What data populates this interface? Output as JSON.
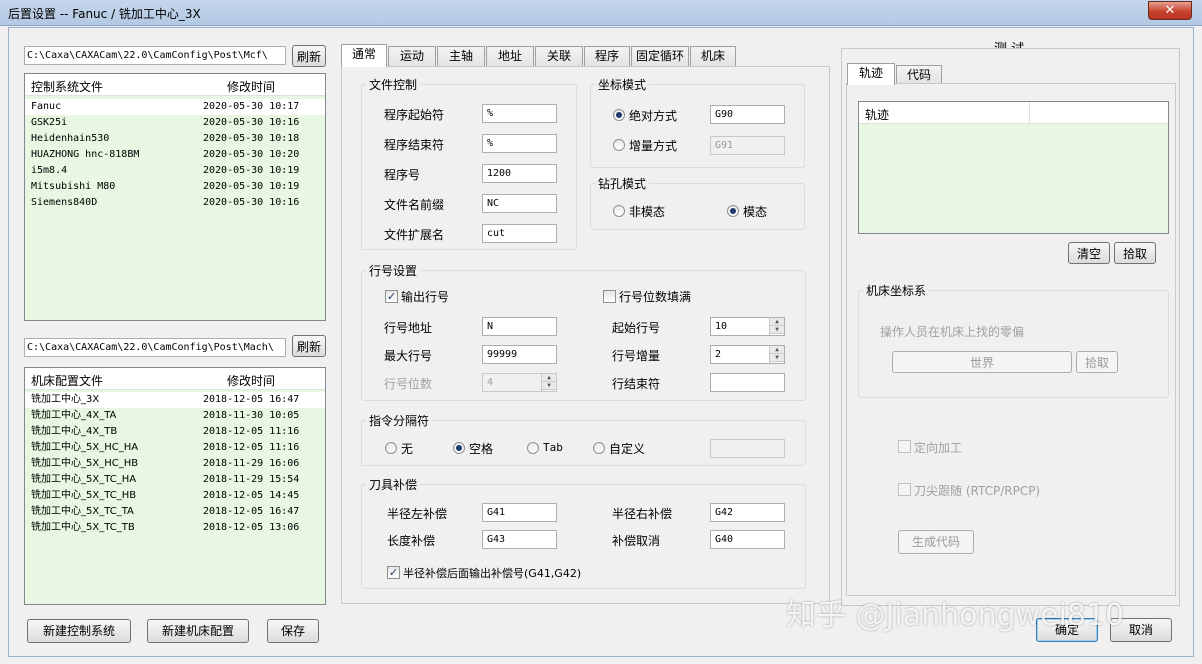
{
  "window": {
    "title": "后置设置 -- Fanuc / 铣加工中心_3X",
    "close_glyph": "✕"
  },
  "left": {
    "controller_path": "C:\\Caxa\\CAXACam\\22.0\\CamConfig\\Post\\Mcf\\",
    "refresh_label": "刷新",
    "controller_list": {
      "col_name": "控制系统文件",
      "col_time": "修改时间",
      "rows": [
        {
          "name": "Fanuc",
          "time": "2020-05-30 10:17"
        },
        {
          "name": "GSK25i",
          "time": "2020-05-30 10:16"
        },
        {
          "name": "Heidenhain530",
          "time": "2020-05-30 10:18"
        },
        {
          "name": "HUAZHONG hnc-818BM",
          "time": "2020-05-30 10:20"
        },
        {
          "name": "i5m8.4",
          "time": "2020-05-30 10:19"
        },
        {
          "name": "Mitsubishi M80",
          "time": "2020-05-30 10:19"
        },
        {
          "name": "Siemens840D",
          "time": "2020-05-30 10:16"
        }
      ]
    },
    "machine_path": "C:\\Caxa\\CAXACam\\22.0\\CamConfig\\Post\\Mach\\",
    "machine_list": {
      "col_name": "机床配置文件",
      "col_time": "修改时间",
      "rows": [
        {
          "name": "铣加工中心_3X",
          "time": "2018-12-05 16:47"
        },
        {
          "name": "铣加工中心_4X_TA",
          "time": "2018-11-30 10:05"
        },
        {
          "name": "铣加工中心_4X_TB",
          "time": "2018-12-05 11:16"
        },
        {
          "name": "铣加工中心_5X_HC_HA",
          "time": "2018-12-05 11:16"
        },
        {
          "name": "铣加工中心_5X_HC_HB",
          "time": "2018-11-29 16:06"
        },
        {
          "name": "铣加工中心_5X_TC_HA",
          "time": "2018-11-29 15:54"
        },
        {
          "name": "铣加工中心_5X_TC_HB",
          "time": "2018-12-05 14:45"
        },
        {
          "name": "铣加工中心_5X_TC_TA",
          "time": "2018-12-05 16:47"
        },
        {
          "name": "铣加工中心_5X_TC_TB",
          "time": "2018-12-05 13:06"
        }
      ]
    },
    "btn_new_controller": "新建控制系统",
    "btn_new_machine": "新建机床配置",
    "btn_save": "保存"
  },
  "tabs": [
    "通常",
    "运动",
    "主轴",
    "地址",
    "关联",
    "程序",
    "固定循环",
    "机床"
  ],
  "general": {
    "file_control": {
      "title": "文件控制",
      "prog_start_label": "程序起始符",
      "prog_start": "%",
      "prog_end_label": "程序结束符",
      "prog_end": "%",
      "prog_no_label": "程序号",
      "prog_no": "1200",
      "file_prefix_label": "文件名前缀",
      "file_prefix": "NC",
      "file_ext_label": "文件扩展名",
      "file_ext": "cut"
    },
    "coord_mode": {
      "title": "坐标模式",
      "absolute_label": "绝对方式",
      "absolute_code": "G90",
      "incremental_label": "增量方式",
      "incremental_code": "G91"
    },
    "drill_mode": {
      "title": "钻孔模式",
      "non_modal": "非模态",
      "modal": "模态"
    },
    "line_no": {
      "title": "行号设置",
      "output_label": "输出行号",
      "fill_label": "行号位数填满",
      "address_label": "行号地址",
      "address": "N",
      "start_label": "起始行号",
      "start": "10",
      "max_label": "最大行号",
      "max": "99999",
      "increment_label": "行号增量",
      "increment": "2",
      "digits_label": "行号位数",
      "digits": "4",
      "end_label": "行结束符",
      "end": ""
    },
    "separator": {
      "title": "指令分隔符",
      "none": "无",
      "space": "空格",
      "tab": "Tab",
      "custom": "自定义",
      "custom_value": ""
    },
    "tool_comp": {
      "title": "刀具补偿",
      "left_label": "半径左补偿",
      "left": "G41",
      "right_label": "半径右补偿",
      "right": "G42",
      "length_label": "长度补偿",
      "length": "G43",
      "cancel_label": "补偿取消",
      "cancel": "G40",
      "output_no_label": "半径补偿后面输出补偿号(G41,G42)"
    }
  },
  "test": {
    "title": "测  试",
    "tab_track": "轨迹",
    "tab_code": "代码",
    "track_header": "轨迹",
    "btn_clear": "清空",
    "btn_pick": "拾取",
    "machine_coord_title": "机床坐标系",
    "machine_coord_hint": "操作人员在机床上找的零偏",
    "world_label": "世界",
    "pick_label": "拾取",
    "directional_label": "定向加工",
    "rtcp_label": "刀尖跟随 (RTCP/RPCP)",
    "gen_code_label": "生成代码"
  },
  "footer": {
    "ok": "确定",
    "cancel": "取消"
  },
  "watermark": "知乎 @Jianhongwei810"
}
